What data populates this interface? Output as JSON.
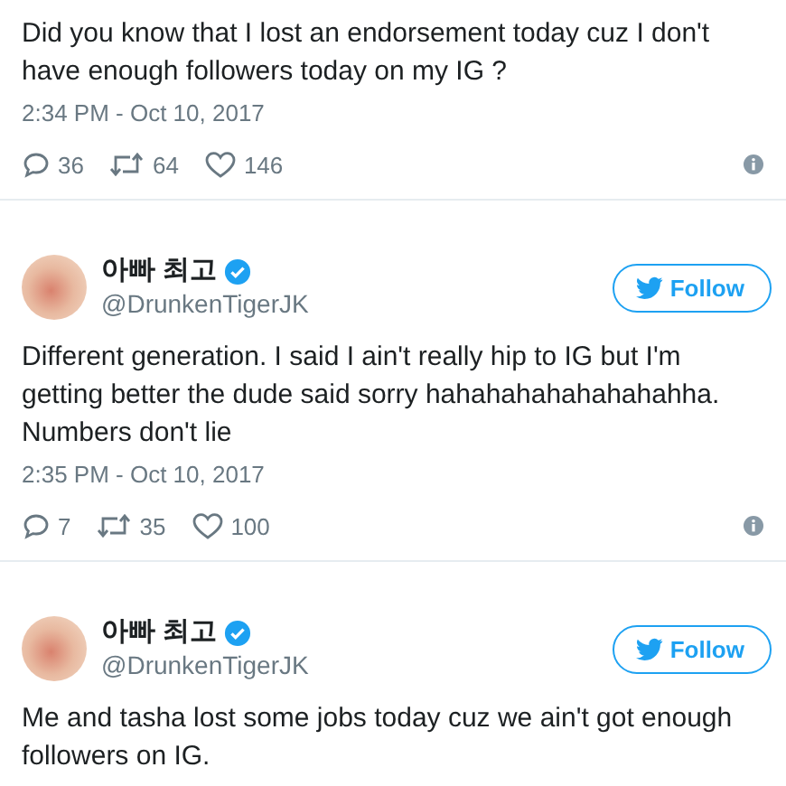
{
  "tweets": [
    {
      "text": "Did you know that I lost an endorsement today cuz I don't have enough followers today on my IG ?",
      "time": "2:34 PM - Oct 10, 2017",
      "actions": {
        "replies": "36",
        "retweets": "64",
        "likes": "146"
      }
    },
    {
      "author": {
        "name": "아빠 최고",
        "handle": "@DrunkenTigerJK",
        "verified": true
      },
      "follow": "Follow",
      "text": "Different generation. I said I ain't really hip to IG but I'm getting better the dude said sorry hahahahahahahahahha. Numbers don't lie",
      "time": "2:35 PM - Oct 10, 2017",
      "actions": {
        "replies": "7",
        "retweets": "35",
        "likes": "100"
      }
    },
    {
      "author": {
        "name": "아빠 최고",
        "handle": "@DrunkenTigerJK",
        "verified": true
      },
      "follow": "Follow",
      "text": "Me and tasha lost some jobs today cuz we ain't got enough followers on IG."
    }
  ]
}
